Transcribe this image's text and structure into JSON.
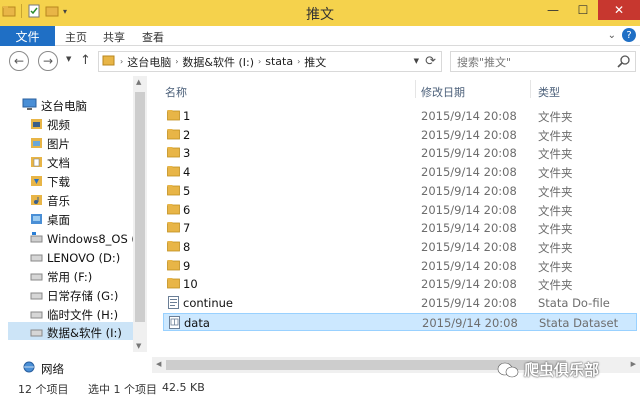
{
  "window": {
    "title": "推文",
    "minimize_glyph": "—",
    "maximize_glyph": "☐",
    "close_glyph": "✕"
  },
  "ribbon": {
    "file_tab": "文件",
    "tabs": [
      "主页",
      "共享",
      "查看"
    ],
    "expand_glyph": "⌄",
    "help_glyph": "?"
  },
  "nav": {
    "back_glyph": "←",
    "forward_glyph": "→",
    "up_glyph": "↑",
    "breadcrumb": [
      "这台电脑",
      "数据&软件 (I:)",
      "stata",
      "推文"
    ],
    "search_placeholder": "搜索\"推文\""
  },
  "tree": [
    {
      "label": "这台电脑",
      "icon": "computer-icon"
    },
    {
      "label": "视频",
      "icon": "video-folder-icon"
    },
    {
      "label": "图片",
      "icon": "pictures-folder-icon"
    },
    {
      "label": "文档",
      "icon": "documents-folder-icon"
    },
    {
      "label": "下载",
      "icon": "downloads-folder-icon"
    },
    {
      "label": "音乐",
      "icon": "music-folder-icon"
    },
    {
      "label": "桌面",
      "icon": "desktop-folder-icon"
    },
    {
      "label": "Windows8_OS (C",
      "icon": "windows-drive-icon"
    },
    {
      "label": "LENOVO (D:)",
      "icon": "drive-icon"
    },
    {
      "label": "常用 (F:)",
      "icon": "drive-icon"
    },
    {
      "label": "日常存储 (G:)",
      "icon": "drive-icon"
    },
    {
      "label": "临时文件 (H:)",
      "icon": "drive-icon"
    },
    {
      "label": "数据&软件 (I:)",
      "icon": "drive-icon"
    },
    {
      "label": "网络",
      "icon": "network-icon"
    }
  ],
  "columns": {
    "name": "名称",
    "date": "修改日期",
    "type": "类型"
  },
  "files": [
    {
      "name": "1",
      "date": "2015/9/14 20:08",
      "type": "文件夹",
      "icon": "folder-icon"
    },
    {
      "name": "2",
      "date": "2015/9/14 20:08",
      "type": "文件夹",
      "icon": "folder-icon"
    },
    {
      "name": "3",
      "date": "2015/9/14 20:08",
      "type": "文件夹",
      "icon": "folder-icon"
    },
    {
      "name": "4",
      "date": "2015/9/14 20:08",
      "type": "文件夹",
      "icon": "folder-icon"
    },
    {
      "name": "5",
      "date": "2015/9/14 20:08",
      "type": "文件夹",
      "icon": "folder-icon"
    },
    {
      "name": "6",
      "date": "2015/9/14 20:08",
      "type": "文件夹",
      "icon": "folder-icon"
    },
    {
      "name": "7",
      "date": "2015/9/14 20:08",
      "type": "文件夹",
      "icon": "folder-icon"
    },
    {
      "name": "8",
      "date": "2015/9/14 20:08",
      "type": "文件夹",
      "icon": "folder-icon"
    },
    {
      "name": "9",
      "date": "2015/9/14 20:08",
      "type": "文件夹",
      "icon": "folder-icon"
    },
    {
      "name": "10",
      "date": "2015/9/14 20:08",
      "type": "文件夹",
      "icon": "folder-icon"
    },
    {
      "name": "continue",
      "date": "2015/9/14 20:08",
      "type": "Stata Do-file",
      "icon": "do-file-icon"
    },
    {
      "name": "data",
      "date": "2015/9/14 20:08",
      "type": "Stata Dataset",
      "icon": "dataset-icon",
      "selected": true
    }
  ],
  "status": {
    "item_count": "12 个项目",
    "selection": "选中 1 个项目",
    "size": "42.5 KB"
  },
  "watermark": {
    "text": "爬虫俱乐部"
  },
  "colors": {
    "titlebar": "#f5d24c",
    "file_tab": "#1f6fc5",
    "close": "#c7372f",
    "selection": "#cce8ff",
    "folder": "#e8b547"
  }
}
